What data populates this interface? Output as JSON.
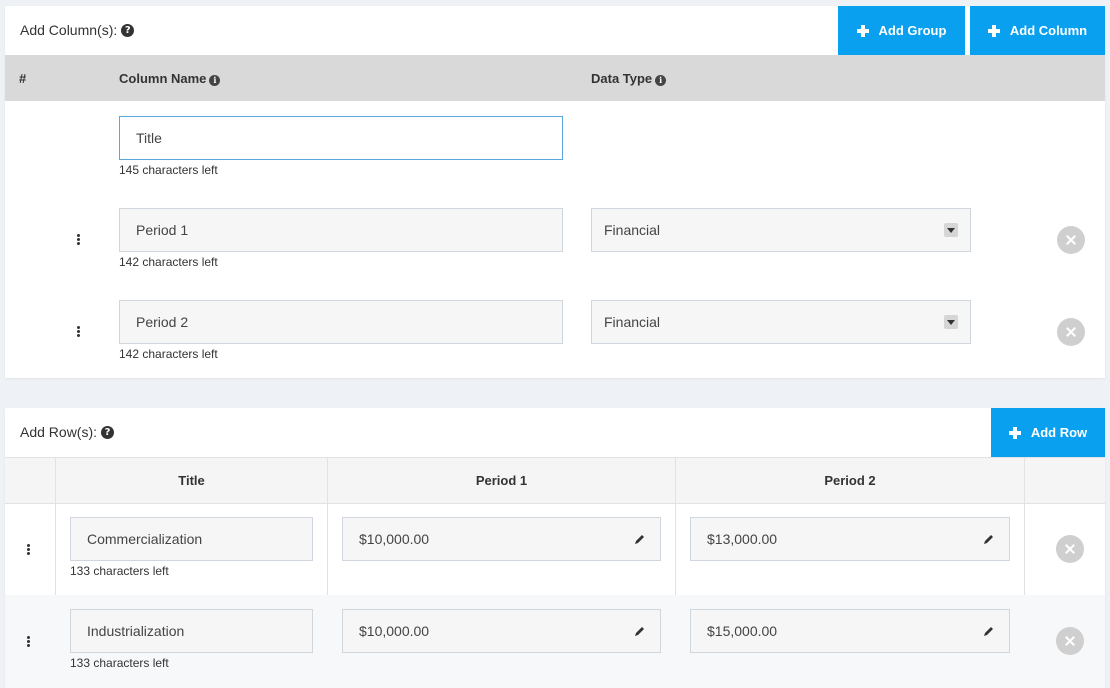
{
  "columns_panel": {
    "title": "Add Column(s):",
    "add_group_label": "Add Group",
    "add_column_label": "Add Column",
    "headers": {
      "number": "#",
      "column_name": "Column Name",
      "data_type": "Data Type"
    },
    "rows": [
      {
        "name": "Title",
        "hint": "145 characters left"
      },
      {
        "name": "Period 1",
        "hint": "142 characters left",
        "type": "Financial"
      },
      {
        "name": "Period 2",
        "hint": "142 characters left",
        "type": "Financial"
      }
    ]
  },
  "rows_panel": {
    "title": "Add Row(s):",
    "add_row_label": "Add Row",
    "headers": {
      "title": "Title",
      "period1": "Period 1",
      "period2": "Period 2"
    },
    "rows": [
      {
        "title": "Commercialization",
        "hint": "133 characters left",
        "period1": "$10,000.00",
        "period2": "$13,000.00"
      },
      {
        "title": "Industrialization",
        "hint": "133 characters left",
        "period1": "$10,000.00",
        "period2": "$15,000.00"
      }
    ]
  },
  "colors": {
    "accent": "#0aa0f0",
    "header_bg": "#d9d9d9",
    "remove": "#cfcfcf"
  }
}
